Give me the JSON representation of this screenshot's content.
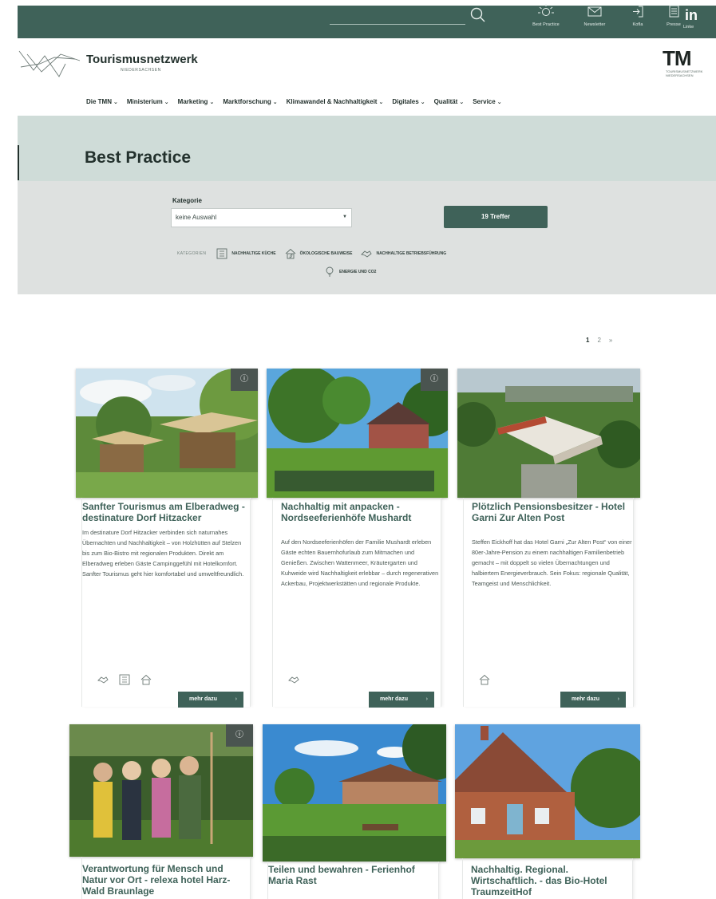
{
  "topbar": {
    "items": [
      {
        "label": "Best Practice",
        "icon": "sun-icon"
      },
      {
        "label": "Newsletter",
        "icon": "envelope-icon"
      },
      {
        "label": "Kofla",
        "icon": "login-icon"
      },
      {
        "label": "Presse",
        "icon": "document-icon"
      }
    ],
    "linkedin_logo": "in",
    "linkedin_label": "Linke"
  },
  "brand": {
    "name": "Tourismusnetzwerk",
    "subtitle": "NIEDERSACHSEN",
    "tmn_logo": "TM",
    "tmn_sub": "TOURISMUSNETZWERK NIEDERSACHSEN"
  },
  "nav": [
    "Die TMN",
    "Ministerium",
    "Marketing",
    "Marktforschung",
    "Klimawandel & Nachhaltigkeit",
    "Digitales",
    "Qualität",
    "Service"
  ],
  "page_title": "Best Practice",
  "filter": {
    "label": "Kategorie",
    "select_value": "keine Auswahl",
    "hits_button": "19 Treffer",
    "categories_label": "KATEGORIEN",
    "categories": [
      "NACHHALTIGE KÜCHE",
      "ÖKOLOGISCHE BAUWEISE",
      "NACHHALTIGE BETRIEBSFÜHRUNG",
      "ENERGIE UND CO2"
    ]
  },
  "pagination": [
    "1",
    "2",
    "»"
  ],
  "cards": [
    {
      "title": "Sanfter Tourismus am Elberadweg - destinature Dorf Hitzacker",
      "text": "Im destinature Dorf Hitzacker verbinden sich naturnahes Übernachten und Nachhaltigkeit – von Holzhütten auf Stelzen bis zum Bio-Bistro mit regionalen Produkten. Direkt am Elberadweg erleben Gäste Campinggefühl mit Hotelkomfort. Sanfter Tourismus geht hier komfortabel und umweltfreundlich.",
      "more": "mehr dazu"
    },
    {
      "title": "Nachhaltig mit anpacken - Nordseeferienhöfe Mushardt",
      "text": "Auf den Nordseeferienhöfen der Familie Mushardt erleben Gäste echten Bauernhofurlaub zum Mitmachen und Genießen. Zwischen Wattenmeer, Kräutergarten und Kuhweide wird Nachhaltigkeit erlebbar – durch regenerativen Ackerbau, Projektwerkstätten und regionale Produkte.",
      "more": "mehr dazu"
    },
    {
      "title": "Plötzlich Pensionsbesitzer - Hotel Garni Zur Alten Post",
      "text": "Steffen Eickhoff hat das Hotel Garni „Zur Alten Post“ von einer 80er-Jahre-Pension zu einem nachhaltigen Familienbetrieb gemacht – mit doppelt so vielen Übernachtungen und halbiertem Energieverbrauch. Sein Fokus: regionale Qualität, Teamgeist und Menschlichkeit.",
      "more": "mehr dazu"
    },
    {
      "title": "Verantwortung für Mensch und Natur vor Ort - relexa hotel Harz-Wald Braunlage"
    },
    {
      "title": "Teilen und bewahren - Ferienhof Maria Rast"
    },
    {
      "title": "Nachhaltig. Regional. Wirtschaftlich. - das Bio-Hotel TraumzeitHof"
    }
  ],
  "colors": {
    "brand_green": "#3f6259",
    "hero_bg": "#cfdcd8",
    "filter_bg": "#dee1e0"
  }
}
